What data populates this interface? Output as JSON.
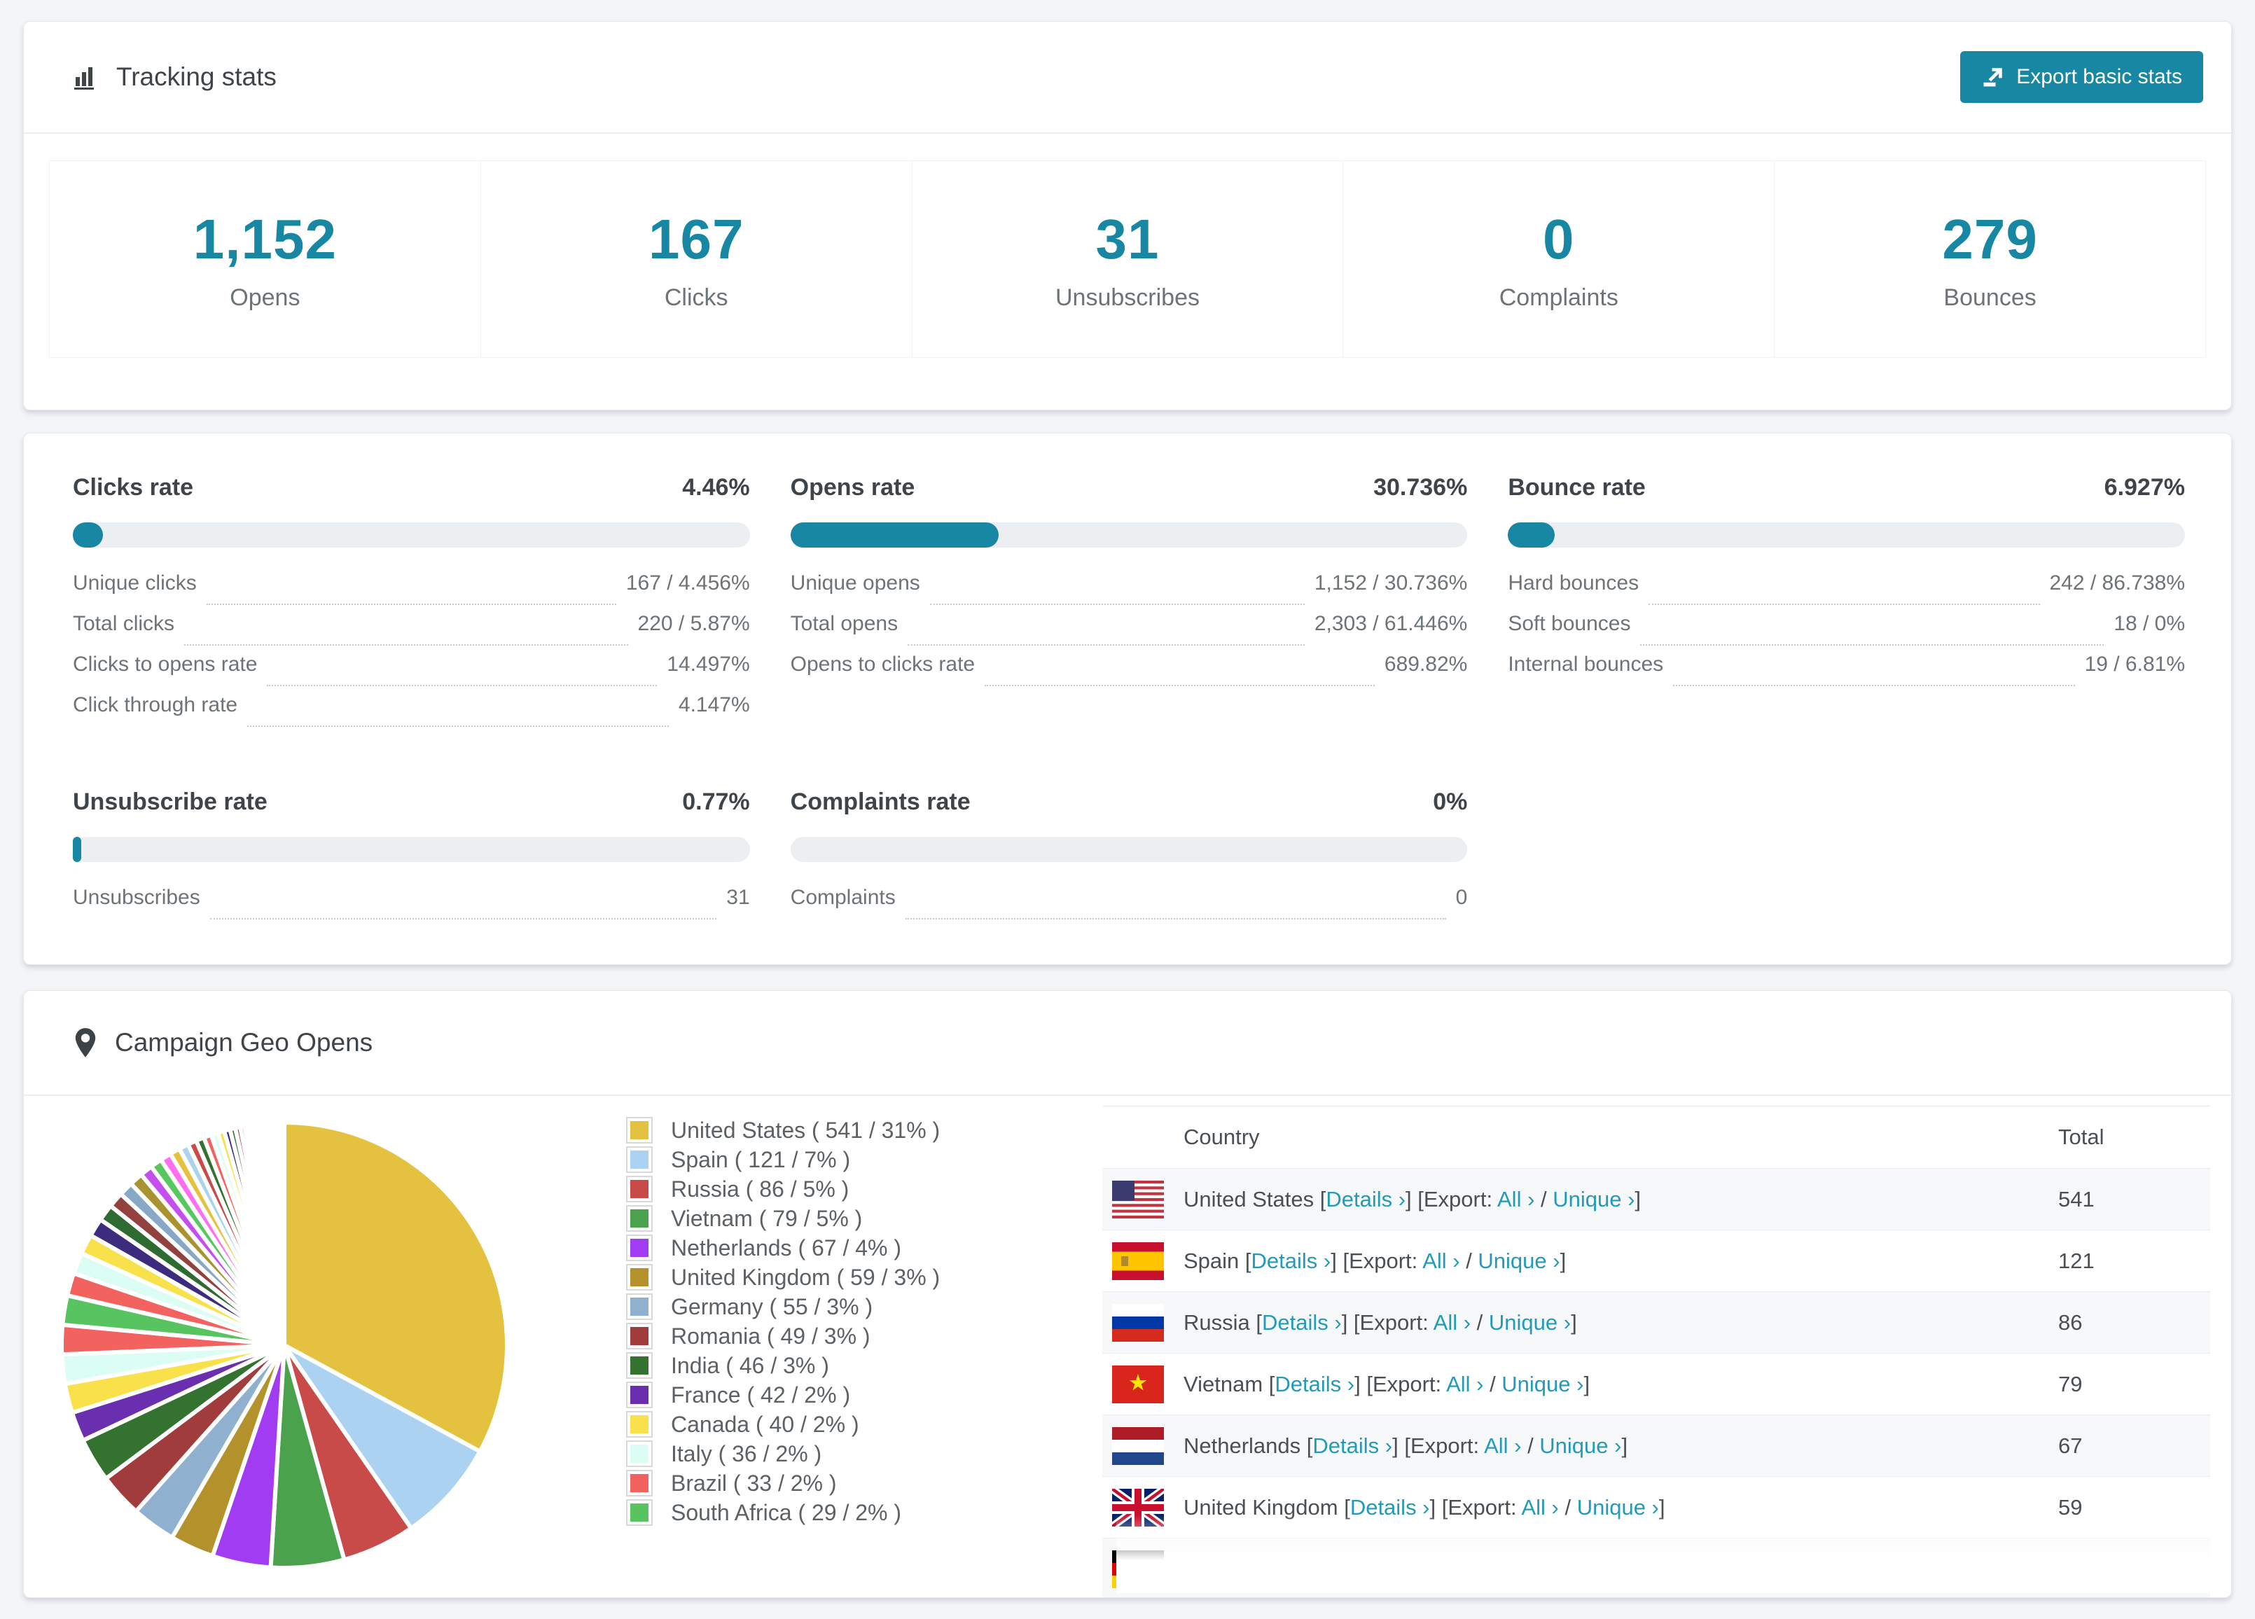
{
  "accent_color": "#1787a3",
  "link_color": "#239ab8",
  "tracking": {
    "title": "Tracking stats",
    "export_label": "Export basic stats",
    "stats": [
      {
        "value": "1,152",
        "label": "Opens"
      },
      {
        "value": "167",
        "label": "Clicks"
      },
      {
        "value": "31",
        "label": "Unsubscribes"
      },
      {
        "value": "0",
        "label": "Complaints"
      },
      {
        "value": "279",
        "label": "Bounces"
      }
    ]
  },
  "rates": [
    {
      "title": "Clicks rate",
      "value": "4.46%",
      "percent": 4.46,
      "rows": [
        {
          "label": "Unique clicks",
          "value": "167 / 4.456%"
        },
        {
          "label": "Total clicks",
          "value": "220 / 5.87%"
        },
        {
          "label": "Clicks to opens rate",
          "value": "14.497%"
        },
        {
          "label": "Click through rate",
          "value": "4.147%"
        }
      ]
    },
    {
      "title": "Opens rate",
      "value": "30.736%",
      "percent": 30.736,
      "rows": [
        {
          "label": "Unique opens",
          "value": "1,152 / 30.736%"
        },
        {
          "label": "Total opens",
          "value": "2,303 / 61.446%"
        },
        {
          "label": "Opens to clicks rate",
          "value": "689.82%"
        }
      ]
    },
    {
      "title": "Bounce rate",
      "value": "6.927%",
      "percent": 6.927,
      "rows": [
        {
          "label": "Hard bounces",
          "value": "242 / 86.738%"
        },
        {
          "label": "Soft bounces",
          "value": "18 / 0%"
        },
        {
          "label": "Internal bounces",
          "value": "19 / 6.81%"
        }
      ]
    },
    {
      "title": "Unsubscribe rate",
      "value": "0.77%",
      "percent": 0.77,
      "rows": [
        {
          "label": "Unsubscribes",
          "value": "31"
        }
      ]
    },
    {
      "title": "Complaints rate",
      "value": "0%",
      "percent": 0,
      "rows": [
        {
          "label": "Complaints",
          "value": "0"
        }
      ]
    }
  ],
  "geo": {
    "title": "Campaign Geo Opens",
    "table": {
      "headers": [
        "Country",
        "Total"
      ],
      "bracket_open": "[",
      "bracket_close": "]",
      "details_label": "Details ›",
      "export_label": "Export:",
      "all_label": "All ›",
      "unique_label": "Unique ›",
      "separator": " / ",
      "rows": [
        {
          "country": "United States",
          "flag": "us",
          "total": "541"
        },
        {
          "country": "Spain",
          "flag": "es",
          "total": "121"
        },
        {
          "country": "Russia",
          "flag": "ru",
          "total": "86"
        },
        {
          "country": "Vietnam",
          "flag": "vn",
          "total": "79"
        },
        {
          "country": "Netherlands",
          "flag": "nl",
          "total": "67"
        },
        {
          "country": "United Kingdom",
          "flag": "gb",
          "total": "59"
        },
        {
          "country": "",
          "flag": "de",
          "total": ""
        }
      ]
    }
  },
  "chart_data": {
    "type": "pie",
    "title": "Campaign Geo Opens",
    "unit": "opens",
    "legend_position": "right",
    "series": [
      {
        "name": "United States",
        "value": 541,
        "pct": 31,
        "color": "#e4c23f"
      },
      {
        "name": "Spain",
        "value": 121,
        "pct": 7,
        "color": "#abd3f1"
      },
      {
        "name": "Russia",
        "value": 86,
        "pct": 5,
        "color": "#c84b49"
      },
      {
        "name": "Vietnam",
        "value": 79,
        "pct": 5,
        "color": "#4aa24d"
      },
      {
        "name": "Netherlands",
        "value": 67,
        "pct": 4,
        "color": "#a13cf2"
      },
      {
        "name": "United Kingdom",
        "value": 59,
        "pct": 3,
        "color": "#b3922c"
      },
      {
        "name": "Germany",
        "value": 55,
        "pct": 3,
        "color": "#8fb0cf"
      },
      {
        "name": "Romania",
        "value": 49,
        "pct": 3,
        "color": "#a03c3c"
      },
      {
        "name": "India",
        "value": 46,
        "pct": 3,
        "color": "#34722f"
      },
      {
        "name": "France",
        "value": 42,
        "pct": 2,
        "color": "#6a2fae"
      },
      {
        "name": "Canada",
        "value": 40,
        "pct": 2,
        "color": "#f8e14b"
      },
      {
        "name": "Italy",
        "value": 36,
        "pct": 2,
        "color": "#dcfdf3"
      },
      {
        "name": "Brazil",
        "value": 33,
        "pct": 2,
        "color": "#f2635f"
      },
      {
        "name": "South Africa",
        "value": 29,
        "pct": 2,
        "color": "#57c45f"
      }
    ],
    "other_slices": [
      {
        "pct": 1.55,
        "color": "#f2635f"
      },
      {
        "pct": 1.45,
        "color": "#dcfdf3"
      },
      {
        "pct": 1.35,
        "color": "#f8e14b"
      },
      {
        "pct": 1.25,
        "color": "#3d2c7d"
      },
      {
        "pct": 1.15,
        "color": "#2e6b30"
      },
      {
        "pct": 1.05,
        "color": "#93413e"
      },
      {
        "pct": 0.98,
        "color": "#87a8c6"
      },
      {
        "pct": 0.92,
        "color": "#a99230"
      },
      {
        "pct": 0.86,
        "color": "#c44ef0"
      },
      {
        "pct": 0.8,
        "color": "#58c75f"
      },
      {
        "pct": 0.75,
        "color": "#ff6ef0"
      },
      {
        "pct": 0.7,
        "color": "#e4c23f"
      },
      {
        "pct": 0.65,
        "color": "#abd3f1"
      },
      {
        "pct": 0.6,
        "color": "#c84b49"
      },
      {
        "pct": 0.56,
        "color": "#34722f"
      },
      {
        "pct": 0.52,
        "color": "#f2635f"
      },
      {
        "pct": 0.48,
        "color": "#dcfdf3"
      },
      {
        "pct": 0.44,
        "color": "#f8e14b"
      },
      {
        "pct": 0.4,
        "color": "#3d2c7d"
      },
      {
        "pct": 0.37,
        "color": "#2e6b30"
      },
      {
        "pct": 0.34,
        "color": "#93413e"
      },
      {
        "pct": 0.31,
        "color": "#87a8c6"
      },
      {
        "pct": 0.28,
        "color": "#a99230"
      },
      {
        "pct": 0.26,
        "color": "#c44ef0"
      },
      {
        "pct": 0.24,
        "color": "#58c75f"
      },
      {
        "pct": 0.22,
        "color": "#ff6ef0"
      },
      {
        "pct": 0.2,
        "color": "#e4c23f"
      },
      {
        "pct": 0.18,
        "color": "#abd3f1"
      },
      {
        "pct": 0.16,
        "color": "#c84b49"
      },
      {
        "pct": 0.14,
        "color": "#34722f"
      },
      {
        "pct": 0.13,
        "color": "#f2635f"
      },
      {
        "pct": 0.12,
        "color": "#dcfdf3"
      },
      {
        "pct": 0.11,
        "color": "#f8e14b"
      },
      {
        "pct": 0.1,
        "color": "#3d2c7d"
      },
      {
        "pct": 0.09,
        "color": "#2e6b30"
      },
      {
        "pct": 0.08,
        "color": "#93413e"
      },
      {
        "pct": 0.07,
        "color": "#87a8c6"
      },
      {
        "pct": 0.06,
        "color": "#a99230"
      },
      {
        "pct": 0.05,
        "color": "#c44ef0"
      },
      {
        "pct": 0.05,
        "color": "#58c75f"
      },
      {
        "pct": 0.04,
        "color": "#ff6ef0"
      },
      {
        "pct": 0.03,
        "color": "#e4c23f"
      },
      {
        "pct": 0.03,
        "color": "#abd3f1"
      },
      {
        "pct": 0.02,
        "color": "#c84b49"
      },
      {
        "pct": 0.02,
        "color": "#34722f"
      }
    ]
  }
}
